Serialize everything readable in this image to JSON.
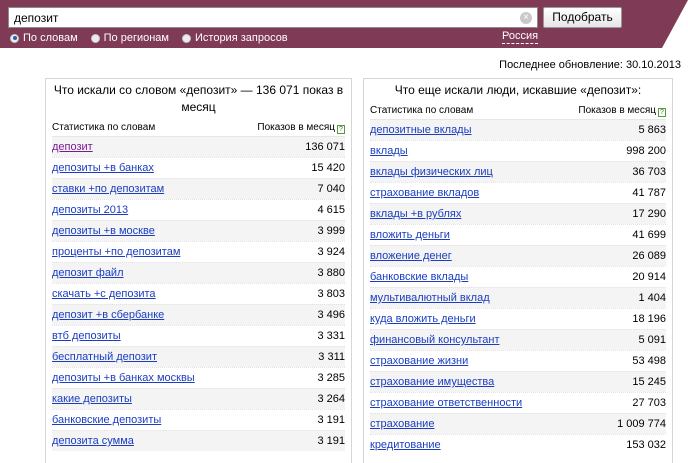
{
  "search": {
    "query": "депозит",
    "submit_label": "Подобрать",
    "clear_icon": "close-icon"
  },
  "modes": [
    {
      "label": "По словам",
      "selected": true
    },
    {
      "label": "По регионам",
      "selected": false
    },
    {
      "label": "История запросов",
      "selected": false
    }
  ],
  "region": "Россия",
  "updated": "Последнее обновление: 30.10.2013",
  "left_panel": {
    "title": "Что искали со словом «депозит» — 136 071 показ в месяц",
    "col_stat": "Статистика по словам",
    "col_views": "Показов в месяц",
    "help": "?",
    "rows": [
      {
        "phrase": "депозит",
        "count": "136 071"
      },
      {
        "phrase": "депозиты +в банках",
        "count": "15 420"
      },
      {
        "phrase": "ставки +по депозитам",
        "count": "7 040"
      },
      {
        "phrase": "депозиты 2013",
        "count": "4 615"
      },
      {
        "phrase": "депозиты +в москве",
        "count": "3 999"
      },
      {
        "phrase": "проценты +по депозитам",
        "count": "3 924"
      },
      {
        "phrase": "депозит файл",
        "count": "3 880"
      },
      {
        "phrase": "скачать +с депозита",
        "count": "3 803"
      },
      {
        "phrase": "депозит +в сбербанке",
        "count": "3 496"
      },
      {
        "phrase": "втб депозиты",
        "count": "3 331"
      },
      {
        "phrase": "бесплатный депозит",
        "count": "3 311"
      },
      {
        "phrase": "депозиты +в банках москвы",
        "count": "3 285"
      },
      {
        "phrase": "какие депозиты",
        "count": "3 264"
      },
      {
        "phrase": "банковские депозиты",
        "count": "3 191"
      },
      {
        "phrase": "депозита сумма",
        "count": "3 191"
      }
    ]
  },
  "right_panel": {
    "title": "Что еще искали люди, искавшие «депозит»:",
    "col_stat": "Статистика по словам",
    "col_views": "Показов в месяц",
    "help": "?",
    "rows": [
      {
        "phrase": "депозитные вклады",
        "count": "5 863"
      },
      {
        "phrase": "вклады",
        "count": "998 200"
      },
      {
        "phrase": "вклады физических лиц",
        "count": "36 703"
      },
      {
        "phrase": "страхование вкладов",
        "count": "41 787"
      },
      {
        "phrase": "вклады +в рублях",
        "count": "17 290"
      },
      {
        "phrase": "вложить деньги",
        "count": "41 699"
      },
      {
        "phrase": "вложение денег",
        "count": "26 089"
      },
      {
        "phrase": "банковские вклады",
        "count": "20 914"
      },
      {
        "phrase": "мультивалютный вклад",
        "count": "1 404"
      },
      {
        "phrase": "куда вложить деньги",
        "count": "18 196"
      },
      {
        "phrase": "финансовый консультант",
        "count": "5 091"
      },
      {
        "phrase": "страхование жизни",
        "count": "53 498"
      },
      {
        "phrase": "страхование имущества",
        "count": "15 245"
      },
      {
        "phrase": "страхование ответственности",
        "count": "27 703"
      },
      {
        "phrase": "страхование",
        "count": "1 009 774"
      },
      {
        "phrase": "кредитование",
        "count": "153 032"
      }
    ]
  }
}
